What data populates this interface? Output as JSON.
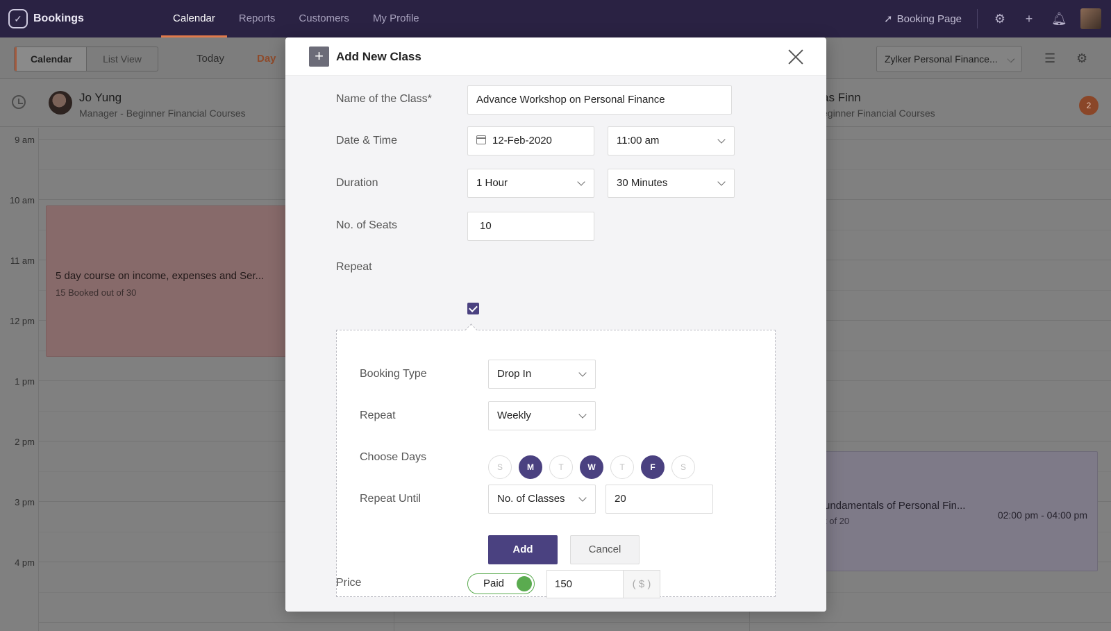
{
  "app": {
    "name": "Bookings"
  },
  "nav": {
    "tabs": [
      {
        "label": "Calendar",
        "active": true
      },
      {
        "label": "Reports"
      },
      {
        "label": "Customers"
      },
      {
        "label": "My Profile"
      }
    ],
    "booking_page_label": "Booking Page"
  },
  "subbar": {
    "views": [
      "Calendar",
      "List View"
    ],
    "today_label": "Today",
    "day_label": "Day",
    "staff_select": "Zylker Personal Finance..."
  },
  "staff": [
    {
      "name": "Jo Yung",
      "role": "Manager - Beginner Financial Courses"
    },
    {
      "name": "as Finn",
      "role": "eginner Financial Courses"
    }
  ],
  "badge_count": "2",
  "times": [
    "9 am",
    "10 am",
    "11 am",
    "12 pm",
    "1 pm",
    "2 pm",
    "3 pm",
    "4 pm"
  ],
  "events": [
    {
      "title": "5 day course on income, expenses and Ser...",
      "subtitle": "15 Booked out of 30"
    },
    {
      "title": "undamentals of Personal Fin...",
      "subtitle": "t of 20",
      "time": "02:00 pm - 04:00 pm"
    }
  ],
  "modal": {
    "title": "Add New Class",
    "labels": {
      "name": "Name of the Class*",
      "datetime": "Date & Time",
      "duration": "Duration",
      "seats": "No. of Seats",
      "repeat": "Repeat",
      "price": "Price"
    },
    "values": {
      "name": "Advance Workshop on Personal Finance",
      "date": "12-Feb-2020",
      "time": "11:00 am",
      "duration_hours": "1 Hour",
      "duration_minutes": "30 Minutes",
      "seats": "10",
      "repeat_checked": true
    },
    "repeat_section": {
      "labels": {
        "booking_type": "Booking Type",
        "repeat": "Repeat",
        "choose_days": "Choose Days",
        "repeat_until": "Repeat Until"
      },
      "booking_type": "Drop In",
      "repeat": "Weekly",
      "days": [
        {
          "label": "S",
          "selected": false
        },
        {
          "label": "M",
          "selected": true
        },
        {
          "label": "T",
          "selected": false
        },
        {
          "label": "W",
          "selected": true
        },
        {
          "label": "T",
          "selected": false
        },
        {
          "label": "F",
          "selected": true
        },
        {
          "label": "S",
          "selected": false
        }
      ],
      "repeat_until_type": "No. of Classes",
      "repeat_until_value": "20",
      "add_label": "Add",
      "cancel_label": "Cancel"
    },
    "price": {
      "toggle_label": "Paid",
      "amount": "150",
      "currency": "( $ )"
    }
  },
  "colors": {
    "nav_bg": "#2a2243",
    "accent": "#4a4180",
    "toggle_green": "#5aab4f",
    "active_tab_underline": "#e07a4b"
  }
}
